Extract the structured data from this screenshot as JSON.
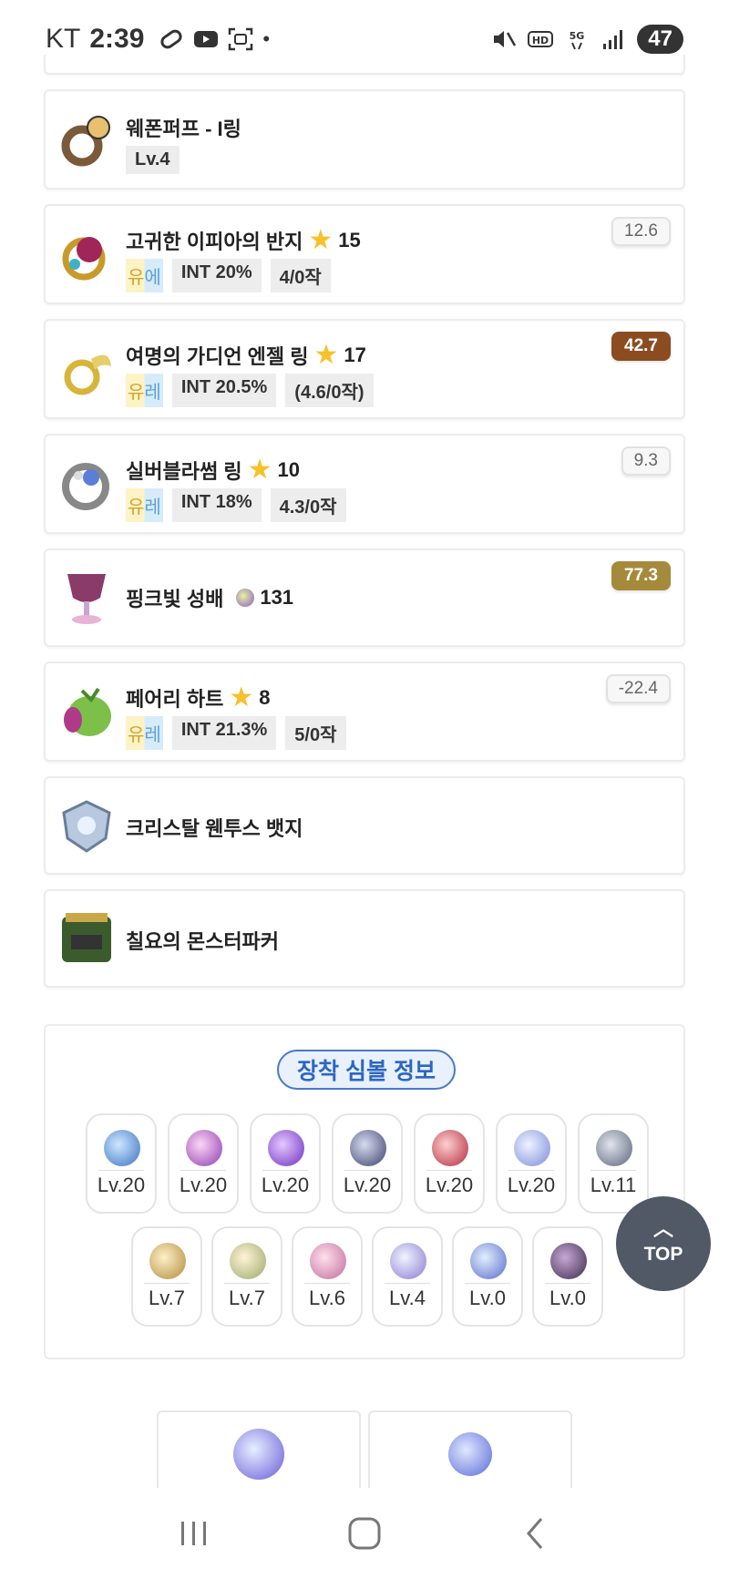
{
  "status": {
    "carrier": "KT",
    "time": "2:39",
    "battery": "47"
  },
  "items": [
    {
      "name": "웨폰퍼프 - I링",
      "tags": [
        "Lv.4"
      ]
    },
    {
      "name": "고귀한 이피아의 반지",
      "stars": "15",
      "grade": [
        "유",
        "에"
      ],
      "tags": [
        "INT 20%",
        "4/0작"
      ],
      "score": "12.6"
    },
    {
      "name": "여명의 가디언 엔젤 링",
      "stars": "17",
      "grade": [
        "유",
        "레"
      ],
      "tags": [
        "INT 20.5%",
        "(4.6/0작)"
      ],
      "score": "42.7"
    },
    {
      "name": "실버블라썸 링",
      "stars": "10",
      "grade": [
        "유",
        "레"
      ],
      "tags": [
        "INT 18%",
        "4.3/0작"
      ],
      "score": "9.3"
    },
    {
      "name": "핑크빛 성배",
      "stars": "131",
      "score": "77.3"
    },
    {
      "name": "페어리 하트",
      "stars": "8",
      "grade": [
        "유",
        "레"
      ],
      "tags": [
        "INT 21.3%",
        "5/0작"
      ],
      "score": "-22.4"
    },
    {
      "name": "크리스탈 웬투스 뱃지"
    },
    {
      "name": "칠요의 몬스터파커"
    }
  ],
  "symbols": {
    "title": "장착 심볼 정보",
    "row1": [
      "Lv.20",
      "Lv.20",
      "Lv.20",
      "Lv.20",
      "Lv.20",
      "Lv.20",
      "Lv.11"
    ],
    "row2": [
      "Lv.7",
      "Lv.7",
      "Lv.6",
      "Lv.4",
      "Lv.0",
      "Lv.0"
    ]
  },
  "top_button": "TOP",
  "icons": {
    "nav": [
      "recent-apps-icon",
      "home-icon",
      "back-icon"
    ]
  }
}
